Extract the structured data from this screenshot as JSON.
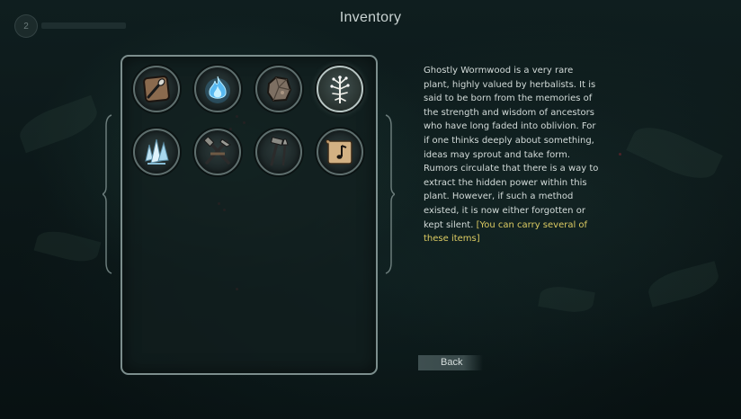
{
  "screen": {
    "title": "Inventory"
  },
  "hud": {
    "level": "2",
    "xp_fraction": 0.0
  },
  "inventory": {
    "selected_index": 3,
    "items": [
      {
        "icon": "leather-fur-scraper-icon"
      },
      {
        "icon": "blue-spirit-flame-icon"
      },
      {
        "icon": "ore-stone-icon"
      },
      {
        "icon": "ghostly-wormwood-plant-icon"
      },
      {
        "icon": "ice-crystal-shards-icon"
      },
      {
        "icon": "crossed-tools-bundle-icon"
      },
      {
        "icon": "hammer-and-chisel-icon"
      },
      {
        "icon": "music-sheet-scroll-icon"
      }
    ]
  },
  "description": {
    "text": "Ghostly Wormwood is a very rare plant, highly valued by herbalists. It is said to be born from the memories of the strength and wisdom of ancestors who have long faded into oblivion. For if one thinks deeply about something, ideas may sprout and take form. Rumors circulate that there is a way to extract the hidden power within this plant. However, if such a method existed, it is now either forgotten or kept silent.",
    "note": "[You can carry several of these items]"
  },
  "controls": {
    "back_label": "Back"
  },
  "colors": {
    "panel_border": "#7c8e8d",
    "text": "#d3dbd9",
    "note": "#dccb62",
    "background": "#0c1819"
  }
}
